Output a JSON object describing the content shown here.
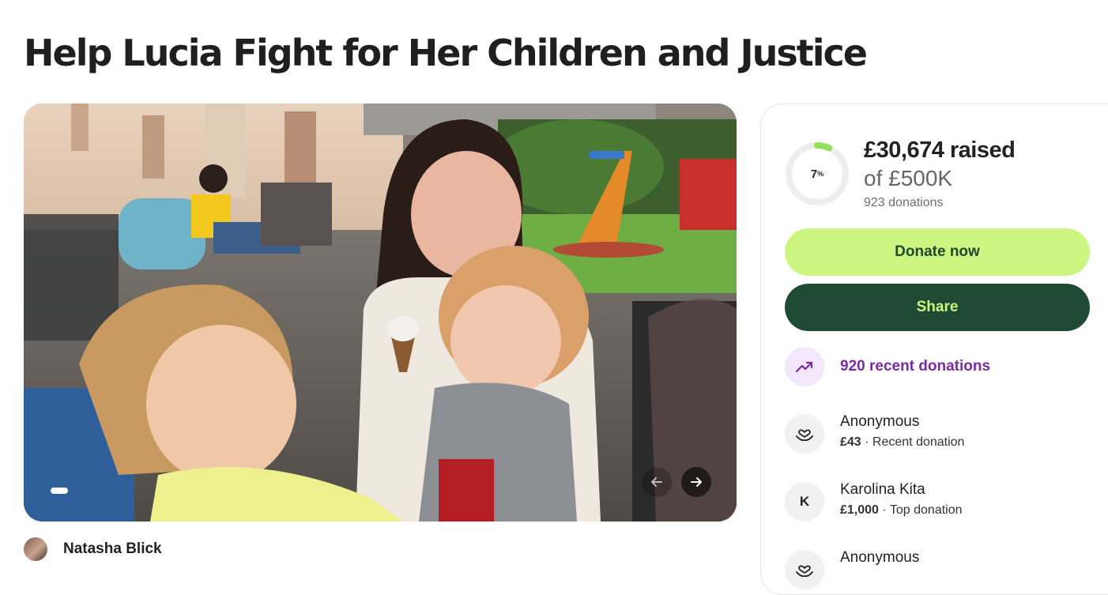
{
  "page": {
    "title": "Help Lucia Fight for Her Children and Justice"
  },
  "organizer": {
    "name": "Natasha Blick"
  },
  "gallery": {
    "slides_shown": 1
  },
  "progress": {
    "percent_label": "7",
    "percent_sign": "%",
    "fraction": 0.07,
    "raised_text": "£30,674 raised",
    "goal_text": "of £500K",
    "donations_text": "923 donations"
  },
  "actions": {
    "donate_label": "Donate now",
    "share_label": "Share"
  },
  "recent": {
    "label": "920 recent donations",
    "icon": "trending-up-icon"
  },
  "donations": [
    {
      "name": "Anonymous",
      "amount": "£43",
      "separator": " · ",
      "type": "Recent donation",
      "avatar_icon": "heart-hand-icon"
    },
    {
      "name": "Karolina Kita",
      "amount": "£1,000",
      "separator": " · ",
      "type": "Top donation",
      "avatar_initial": "K"
    },
    {
      "name": "Anonymous",
      "avatar_icon": "heart-hand-icon"
    }
  ],
  "colors": {
    "accent_green": "#cdf582",
    "dark_green": "#1f4a33",
    "purple": "#7a2aa6",
    "ring_track": "#eeeeee",
    "ring_fill": "#8fe05a"
  }
}
